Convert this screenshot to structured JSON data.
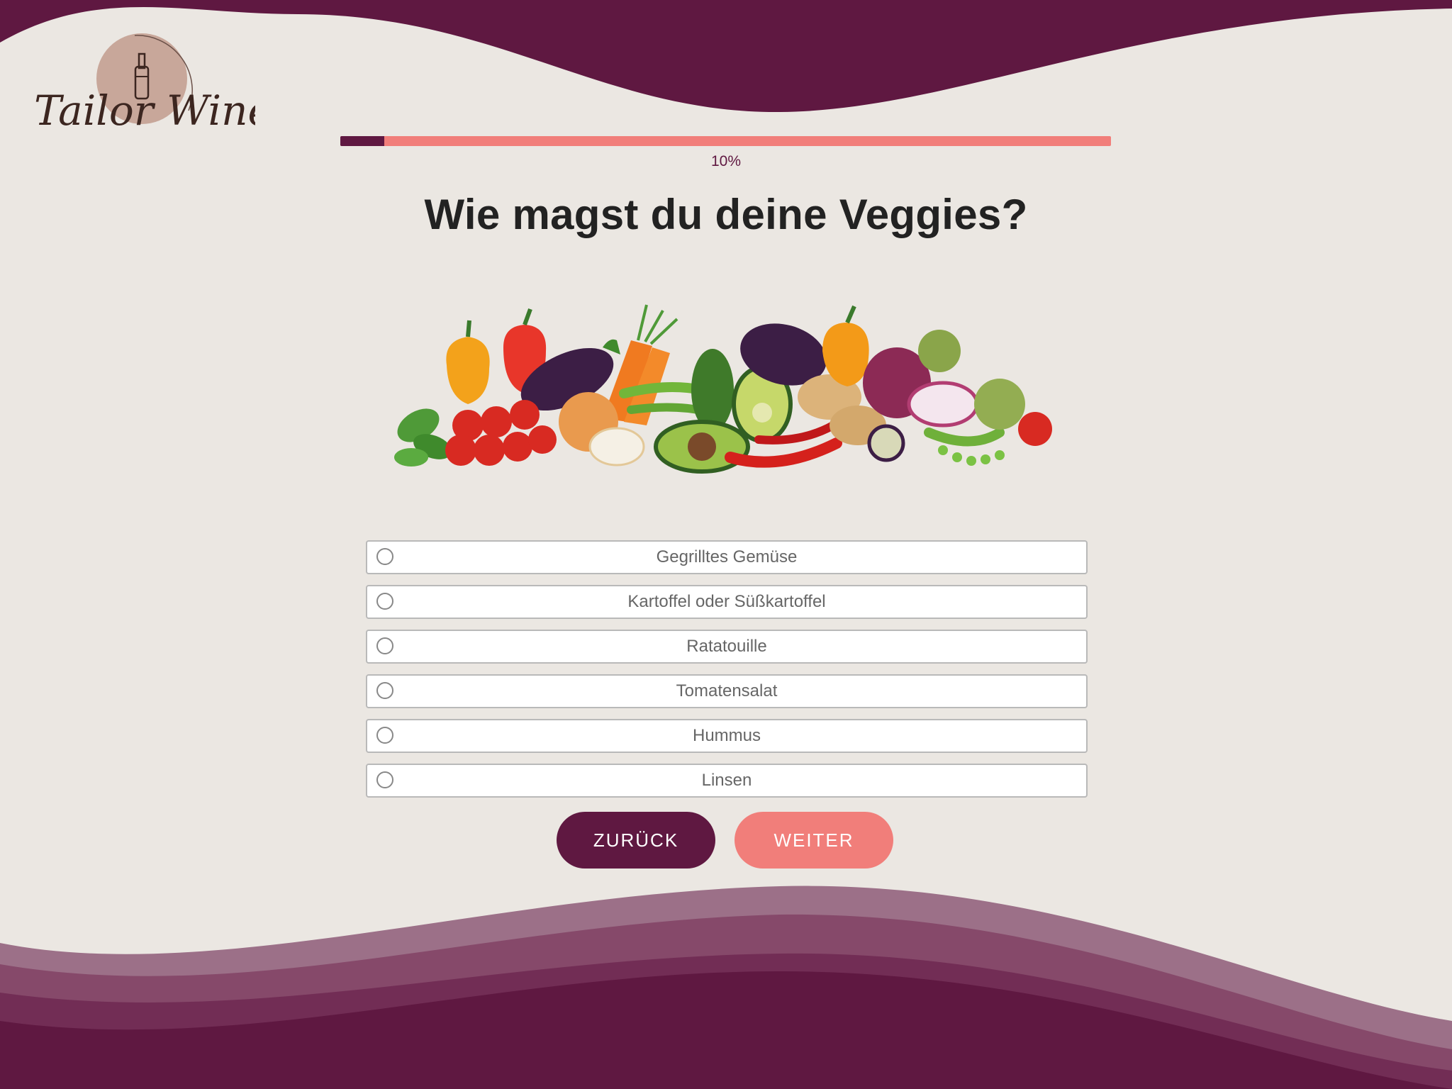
{
  "brand": {
    "name": "TailorWine",
    "logo_script_text": "Tailor Wine"
  },
  "progress": {
    "value": 0.1,
    "label": "10%"
  },
  "question": {
    "title": "Wie magst du deine Veggies?"
  },
  "illustration": {
    "icon": "vegetables-illustration"
  },
  "options": [
    {
      "label": "Gegrilltes Gemüse",
      "selected": false
    },
    {
      "label": "Kartoffel oder Süßkartoffel",
      "selected": false
    },
    {
      "label": "Ratatouille",
      "selected": false
    },
    {
      "label": "Tomatensalat",
      "selected": false
    },
    {
      "label": "Hummus",
      "selected": false
    },
    {
      "label": "Linsen",
      "selected": false
    }
  ],
  "buttons": {
    "back_label": "ZURÜCK",
    "next_label": "WEITER"
  },
  "colors": {
    "brand_primary": "#5f1841",
    "accent": "#f17e7a",
    "background": "#ebe7e2"
  }
}
